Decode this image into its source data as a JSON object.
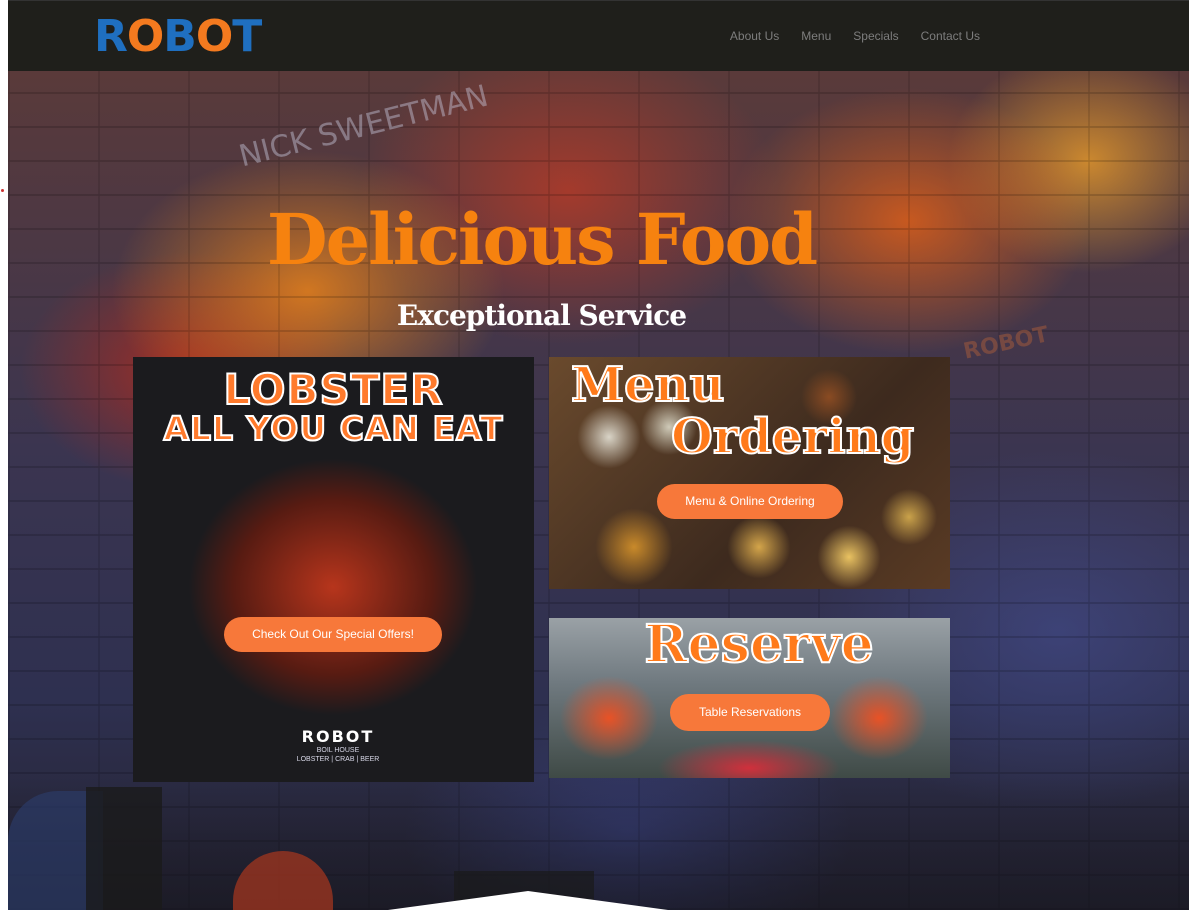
{
  "header": {
    "logo_text": "ROBOT",
    "nav": [
      "About Us",
      "Menu",
      "Specials",
      "Contact Us"
    ]
  },
  "hero": {
    "wall_text": "NICK SWEETMAN",
    "wall_robot": "ROBOT",
    "title": "Delicious Food",
    "subtitle": "Exceptional Service"
  },
  "cards": {
    "lobster": {
      "title_line1": "LOBSTER",
      "title_line2": "ALL YOU CAN EAT",
      "brand": "ROBOT",
      "brand_sub": "BOIL HOUSE",
      "brand_tag": "LOBSTER | CRAB | BEER",
      "button": "Check Out Our Special Offers!"
    },
    "menu": {
      "title_line1": "Menu",
      "title_line2": "Ordering",
      "button": "Menu & Online Ordering"
    },
    "reserve": {
      "title": "Reserve",
      "button": "Table Reservations"
    }
  },
  "colors": {
    "accent_orange": "#f6820f",
    "button_orange": "#f7783a",
    "logo_blue": "#1f6fc0",
    "header_bg": "#1f1f1b"
  }
}
